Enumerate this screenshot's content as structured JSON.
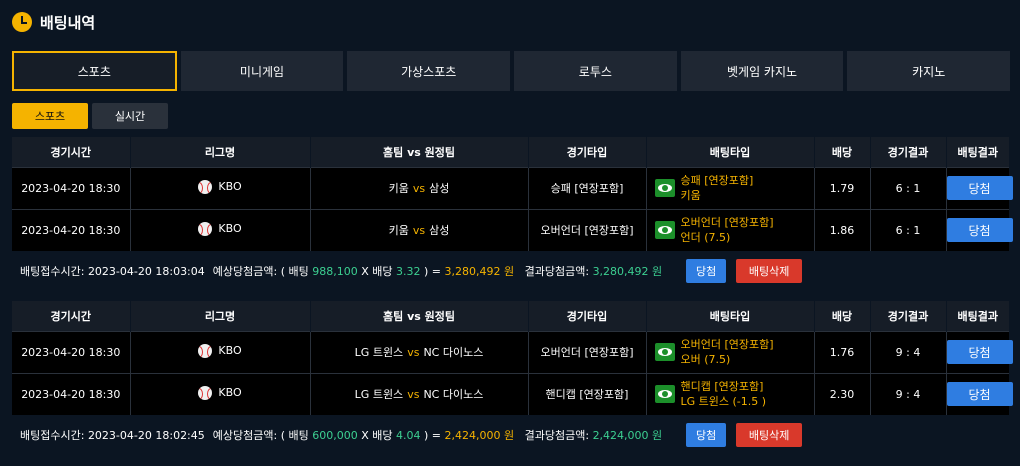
{
  "header": {
    "title": "배팅내역"
  },
  "main_tabs": [
    "스포츠",
    "미니게임",
    "가상스포츠",
    "로투스",
    "벳게임 카지노",
    "카지노"
  ],
  "sub_tabs": [
    "스포츠",
    "실시간"
  ],
  "columns": [
    "경기시간",
    "리그명",
    "홈팀 vs 원정팀",
    "경기타입",
    "배팅타입",
    "배당",
    "경기결과",
    "배팅결과"
  ],
  "vs_label": "vs",
  "bets": [
    {
      "rows": [
        {
          "time": "2023-04-20 18:30",
          "league": "KBO",
          "home": "키움",
          "away": "삼성",
          "type": "승패 [연장포함]",
          "bet_type": "승패 [연장포함]",
          "pick": "키움",
          "odds": "1.79",
          "score": "6 : 1",
          "result": "당첨"
        },
        {
          "time": "2023-04-20 18:30",
          "league": "KBO",
          "home": "키움",
          "away": "삼성",
          "type": "오버언더 [연장포함]",
          "bet_type": "오버언더 [연장포함]",
          "pick": "언더 (7.5)",
          "odds": "1.86",
          "score": "6 : 1",
          "result": "당첨"
        }
      ],
      "summary": {
        "label": "배팅접수시간:",
        "time": "2023-04-20 18:03:04",
        "expected_label": "예상당첨금액: ( 배팅",
        "stake": "988,100",
        "x_label": "X 배당",
        "total_odds": "3.32",
        "eq": ") =",
        "expected": "3,280,492",
        "won": "원",
        "result_label": "결과당첨금액:",
        "result_amount": "3,280,492",
        "result_won": "원",
        "win_btn": "당첨",
        "delete_btn": "배팅삭제"
      }
    },
    {
      "rows": [
        {
          "time": "2023-04-20 18:30",
          "league": "KBO",
          "home": "LG 트윈스",
          "away": "NC 다이노스",
          "type": "오버언더 [연장포함]",
          "bet_type": "오버언더 [연장포함]",
          "pick": "오버 (7.5)",
          "odds": "1.76",
          "score": "9 : 4",
          "result": "당첨"
        },
        {
          "time": "2023-04-20 18:30",
          "league": "KBO",
          "home": "LG 트윈스",
          "away": "NC 다이노스",
          "type": "핸디캡 [연장포함]",
          "bet_type": "핸디캡 [연장포함]",
          "pick": "LG 트윈스 (-1.5 )",
          "odds": "2.30",
          "score": "9 : 4",
          "result": "당첨"
        }
      ],
      "summary": {
        "label": "배팅접수시간:",
        "time": "2023-04-20 18:02:45",
        "expected_label": "예상당첨금액: ( 배팅",
        "stake": "600,000",
        "x_label": "X 배당",
        "total_odds": "4.04",
        "eq": ") =",
        "expected": "2,424,000",
        "won": "원",
        "result_label": "결과당첨금액:",
        "result_amount": "2,424,000",
        "result_won": "원",
        "win_btn": "당첨",
        "delete_btn": "배팅삭제"
      }
    }
  ]
}
